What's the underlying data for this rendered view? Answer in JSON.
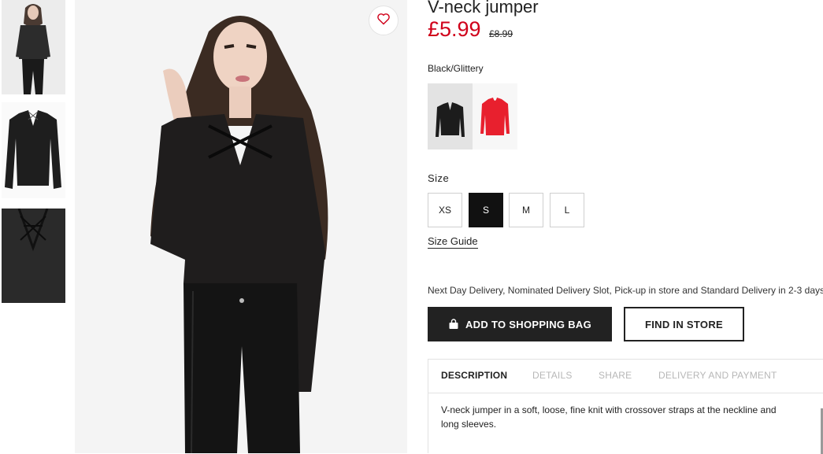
{
  "product": {
    "title": "V-neck jumper",
    "price": "£5.99",
    "old_price": "£8.99",
    "color_name": "Black/Glittery"
  },
  "colors": {
    "accent_price": "#d0021b",
    "swatches": [
      "black",
      "red"
    ]
  },
  "sizes": {
    "label": "Size",
    "options": [
      "XS",
      "S",
      "M",
      "L"
    ],
    "selected": "S",
    "guide_link": "Size Guide"
  },
  "delivery": {
    "text": "Next Day Delivery, Nominated Delivery Slot, Pick-up in store and Standard Delivery in 2-3 days."
  },
  "actions": {
    "add_to_bag": "ADD TO SHOPPING BAG",
    "find_in_store": "FIND IN STORE"
  },
  "tabs": {
    "items": [
      "DESCRIPTION",
      "DETAILS",
      "SHARE",
      "DELIVERY AND PAYMENT"
    ],
    "active": "DESCRIPTION"
  },
  "description": {
    "text": "V-neck jumper in a soft, loose, fine knit with crossover straps at the neckline and long sleeves."
  },
  "icons": {
    "favorite": "heart-icon",
    "bag": "shopping-bag-icon"
  }
}
